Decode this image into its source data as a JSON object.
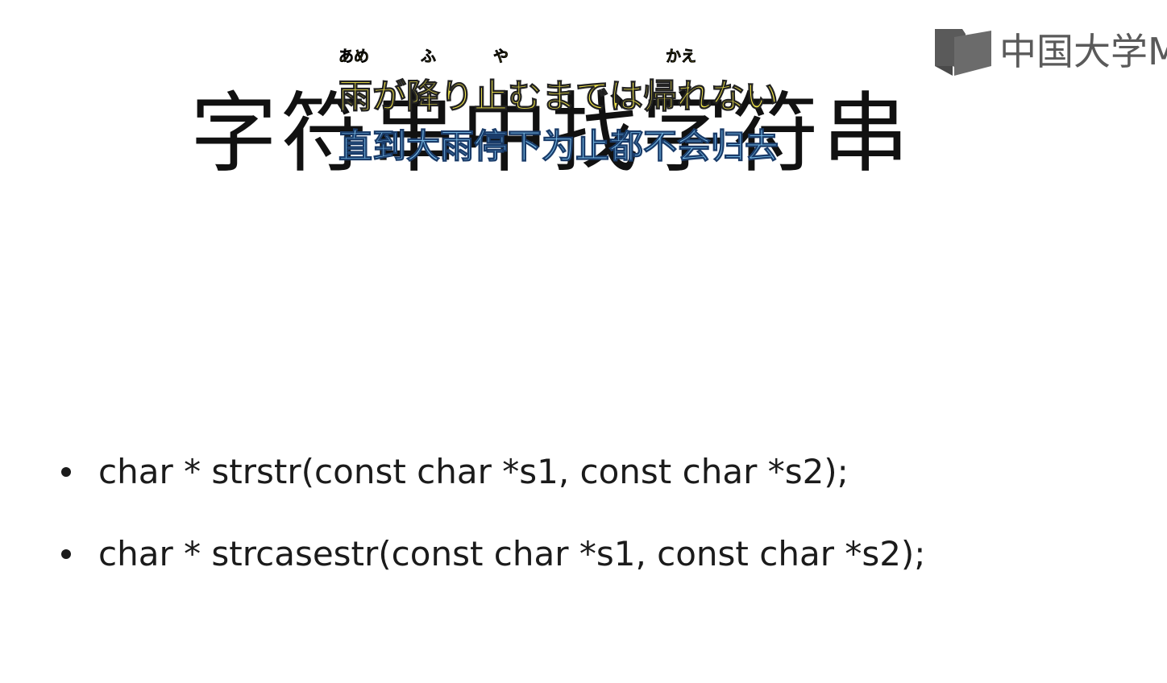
{
  "slide": {
    "title": "字符串中找字符串",
    "bullets": [
      "char * strstr(const char *s1, const char *s2);",
      "char * strcasestr(const char *s1, const char *s2);"
    ]
  },
  "logo": {
    "text": "中国大学M",
    "icon": "book-icon",
    "color": "#5a5a5a"
  },
  "subtitles": {
    "furigana": [
      "あめ",
      "ふ",
      "や",
      "かえ"
    ],
    "japanese": "雨が降り止むまでは帰れない",
    "chinese": "直到大雨停下为止都不会归去",
    "japanese_color": "#f4e84a",
    "chinese_color": "#7fc3ef"
  }
}
